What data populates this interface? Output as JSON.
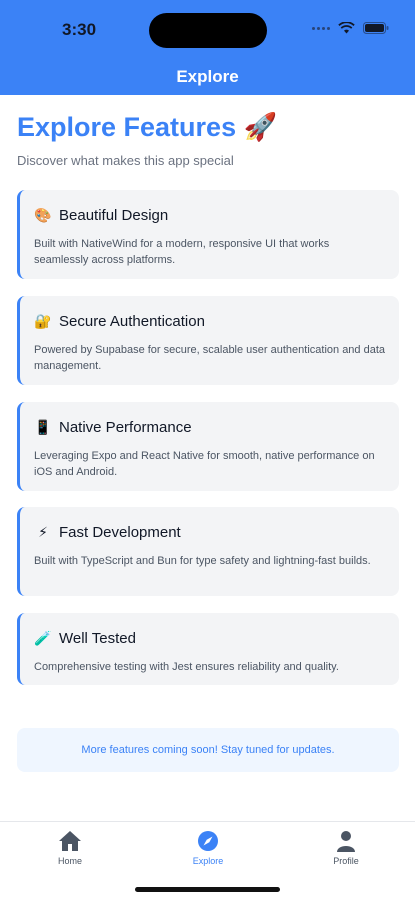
{
  "status_bar": {
    "time": "3:30"
  },
  "header": {
    "title": "Explore"
  },
  "page": {
    "title": "Explore Features 🚀",
    "subtitle": "Discover what makes this app special"
  },
  "features": [
    {
      "emoji": "🎨",
      "title": "Beautiful Design",
      "description": "Built with NativeWind for a modern, responsive UI that works seamlessly across platforms."
    },
    {
      "emoji": "🔐",
      "title": "Secure Authentication",
      "description": "Powered by Supabase for secure, scalable user authentication and data management."
    },
    {
      "emoji": "📱",
      "title": "Native Performance",
      "description": "Leveraging Expo and React Native for smooth, native performance on iOS and Android."
    },
    {
      "emoji": "⚡",
      "title": "Fast Development",
      "description": "Built with TypeScript and Bun for type safety and lightning-fast builds."
    },
    {
      "emoji": "🧪",
      "title": "Well Tested",
      "description": "Comprehensive testing with Jest ensures reliability and quality."
    }
  ],
  "notice": "More features coming soon! Stay tuned for updates.",
  "tabs": [
    {
      "label": "Home",
      "icon": "home-icon"
    },
    {
      "label": "Explore",
      "icon": "compass-icon",
      "active": true
    },
    {
      "label": "Profile",
      "icon": "person-icon"
    }
  ],
  "colors": {
    "accent": "#3b82f6",
    "card_bg": "#f3f4f6",
    "notice_bg": "#eff6ff"
  }
}
